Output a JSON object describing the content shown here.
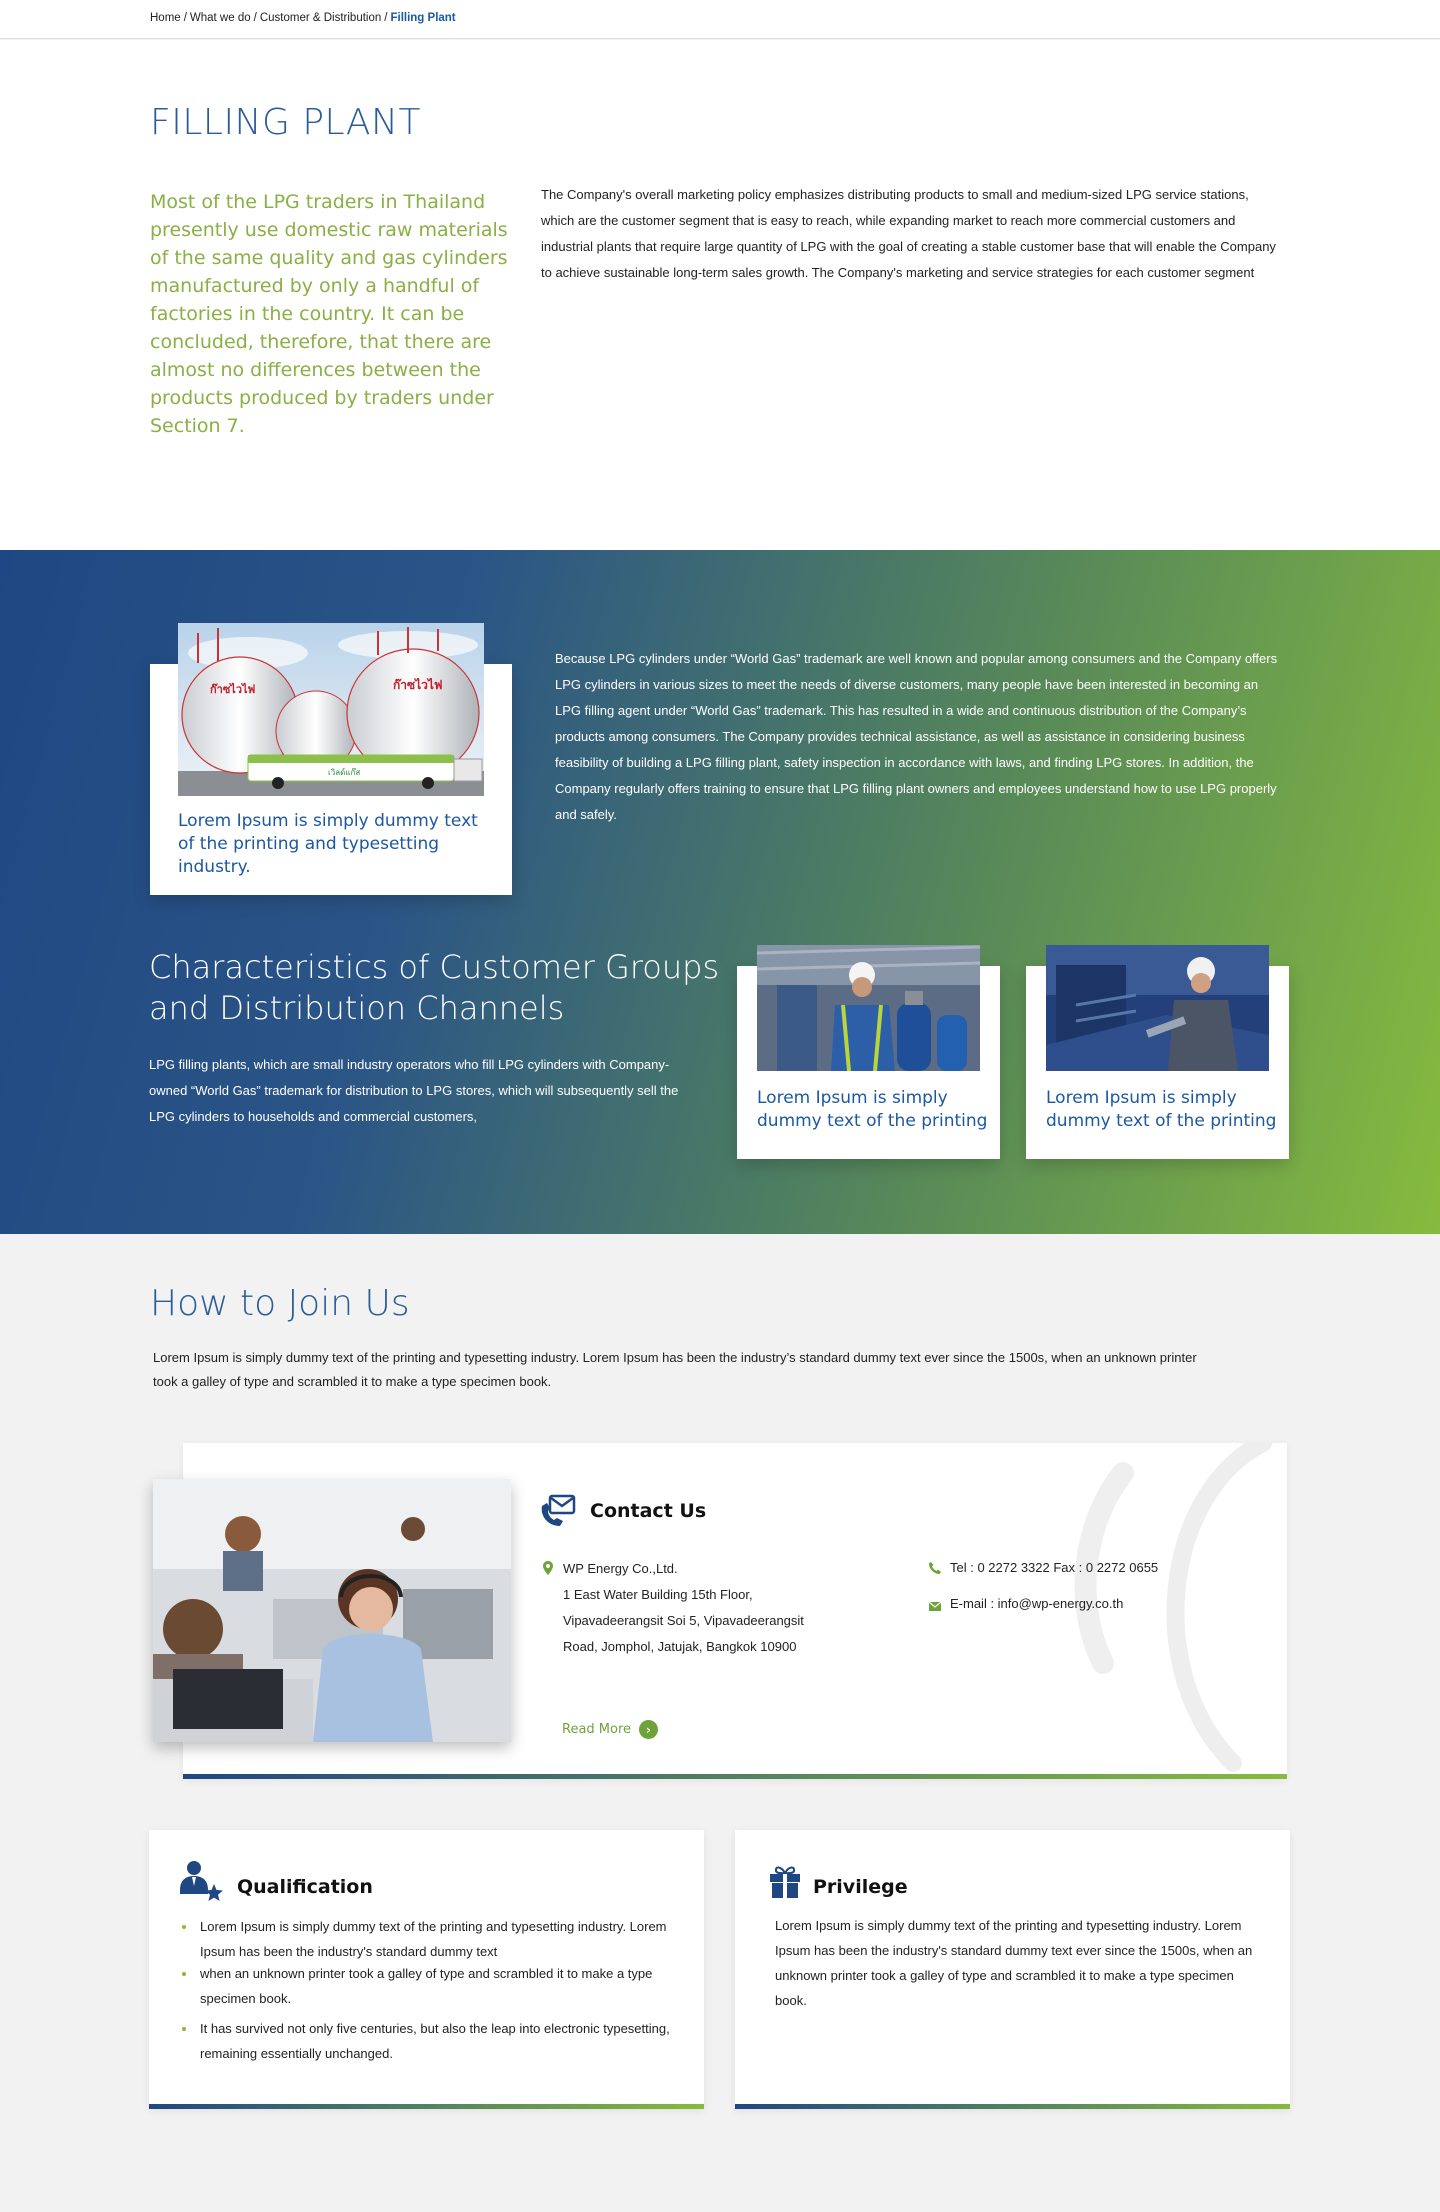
{
  "breadcrumb": {
    "items": [
      "Home",
      "What we do",
      "Customer & Distribution"
    ],
    "current": "Filling Plant",
    "separator": "/"
  },
  "intro": {
    "title": "FILLING PLANT",
    "lead": "Most of the LPG traders in Thailand presently use domestic raw materials of the same quality and gas cylinders manufactured by only a handful of factories in the country. It can be concluded, therefore, that there are almost no differences between the products produced by traders under Section 7.",
    "text": "The Company's overall marketing policy emphasizes distributing products to small and medium-sized LPG service stations, which are the customer segment that is easy to reach, while expanding market to reach more commercial customers and industrial plants that require large quantity of LPG with the goal of creating a stable customer base that will enable the Company to achieve sustainable long-term sales growth. The Company's marketing and service strategies for each customer segment"
  },
  "band": {
    "main_card_caption": "Lorem Ipsum is simply dummy text of the printing and typesetting industry.",
    "text": "Because LPG cylinders under “World Gas” trademark are well known and popular among consumers and the Company offers LPG cylinders in various sizes to meet the needs of diverse customers, many people have been interested in becoming an LPG filling agent under “World Gas” trademark. This has resulted in a wide and continuous distribution of the Company’s products among consumers. The Company provides technical assistance, as well as assistance in considering business feasibility of building a LPG filling plant, safety inspection in accordance with laws, and finding LPG stores. In addition, the Company regularly offers training to ensure that LPG filling plant owners and employees understand how to use LPG properly and safely.",
    "char_title_line1": "Characteristics of Customer Groups",
    "char_title_line2": "and Distribution Channels",
    "char_text": "LPG filling plants, which are small industry operators who fill LPG cylinders with Company-owned “World Gas” trademark for distribution to LPG stores, which will subsequently sell the LPG cylinders to households and commercial customers,",
    "small_card1_caption": "Lorem Ipsum is simply dummy text of the printing",
    "small_card2_caption": "Lorem Ipsum is simply dummy text of the printing",
    "tank_sign_text": "ก๊าซไวไฟ",
    "truck_brand_text": "เวิลด์แก๊ส"
  },
  "join": {
    "title": "How to Join Us",
    "text": "Lorem Ipsum is simply dummy text of the printing and typesetting industry. Lorem Ipsum has been the industry’s standard dummy text ever since the 1500s, when an unknown printer took a galley of type and scrambled it to make a type specimen book."
  },
  "contact": {
    "heading": "Contact Us",
    "company": "WP Energy Co.,Ltd.",
    "address_line1": "1 East Water Building 15th Floor,",
    "address_line2": "Vipavadeerangsit Soi 5, Vipavadeerangsit",
    "address_line3": "Road, Jomphol, Jatujak, Bangkok 10900",
    "phone": "Tel : 0 2272 3322 Fax : 0 2272 0655",
    "email": "E-mail : info@wp-energy.co.th",
    "read_more": "Read More"
  },
  "qualification": {
    "title": "Qualification",
    "items": [
      "Lorem Ipsum is simply dummy text of the printing and typesetting industry. Lorem Ipsum has been the industry's standard dummy text",
      "when an unknown printer took a galley of type and scrambled it to make a type specimen book.",
      "It has survived not only five centuries, but also the leap into electronic typesetting, remaining essentially unchanged."
    ]
  },
  "privilege": {
    "title": "Privilege",
    "text": "Lorem Ipsum is simply dummy text of the printing and typesetting industry. Lorem Ipsum has been the industry's standard dummy text ever since the 1500s, when an unknown printer took a galley of type and scrambled it to make a type specimen book."
  },
  "colors": {
    "brand_blue": "#2a5c98",
    "brand_green": "#86bb3e",
    "lead_green": "#8aaf45",
    "link_green": "#6ea33a"
  },
  "icons": {
    "contact": "envelope-phone-icon",
    "address": "map-pin-icon",
    "phone": "phone-icon",
    "email": "mail-icon",
    "qualification": "user-star-icon",
    "privilege": "gift-icon",
    "read_more": "chevron-right-icon"
  }
}
